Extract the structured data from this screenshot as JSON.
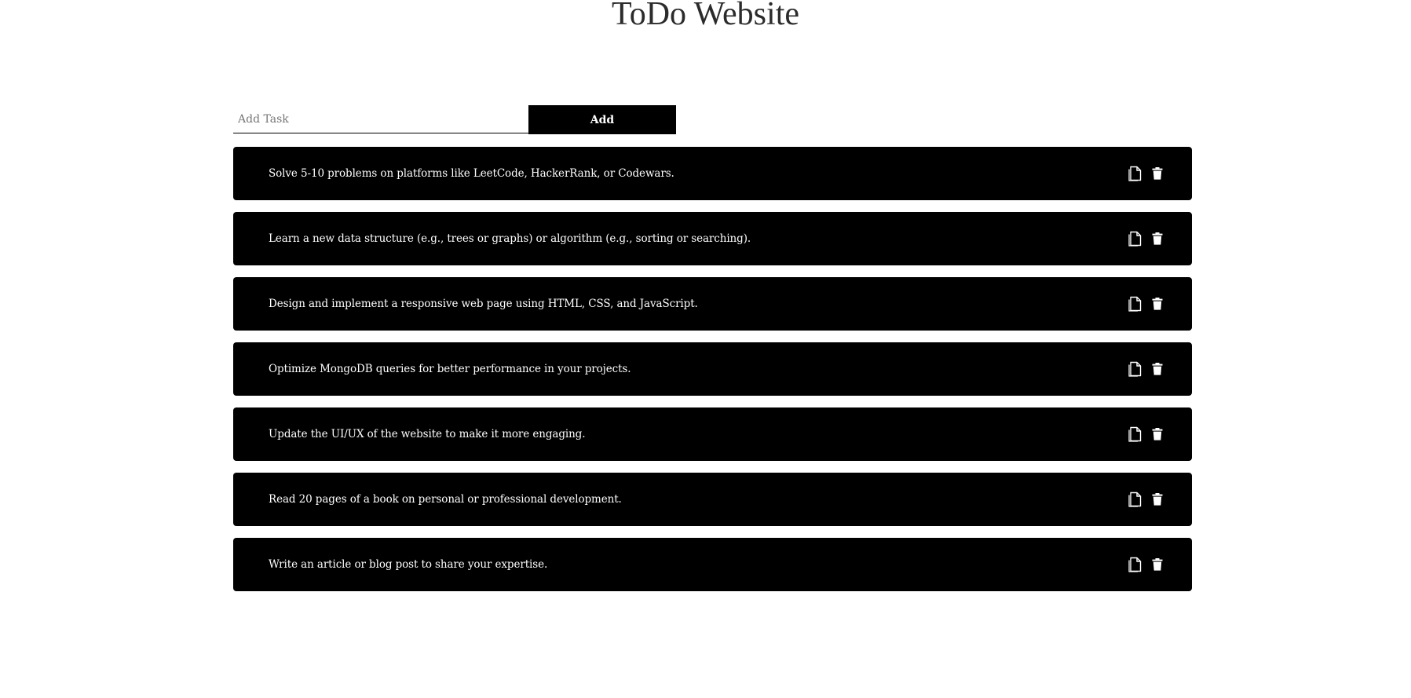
{
  "header": {
    "title": "ToDo Website"
  },
  "add_form": {
    "input_value": "",
    "placeholder": "Add Task",
    "add_label": "Add"
  },
  "tasks": [
    {
      "text": "Solve 5-10 problems on platforms like LeetCode, HackerRank, or Codewars."
    },
    {
      "text": "Learn a new data structure (e.g., trees or graphs) or algorithm (e.g., sorting or searching)."
    },
    {
      "text": "Design and implement a responsive web page using HTML, CSS, and JavaScript."
    },
    {
      "text": "Optimize MongoDB queries for better performance in your projects."
    },
    {
      "text": "Update the UI/UX of the website to make it more engaging."
    },
    {
      "text": "Read 20 pages of a book on personal or professional development."
    },
    {
      "text": "Write an article or blog post to share your expertise."
    }
  ],
  "icons": {
    "edit": "edit-icon",
    "delete": "trash-icon"
  },
  "colors": {
    "task_bg": "#000000",
    "task_text": "#ffffff",
    "button_bg": "#000000"
  }
}
